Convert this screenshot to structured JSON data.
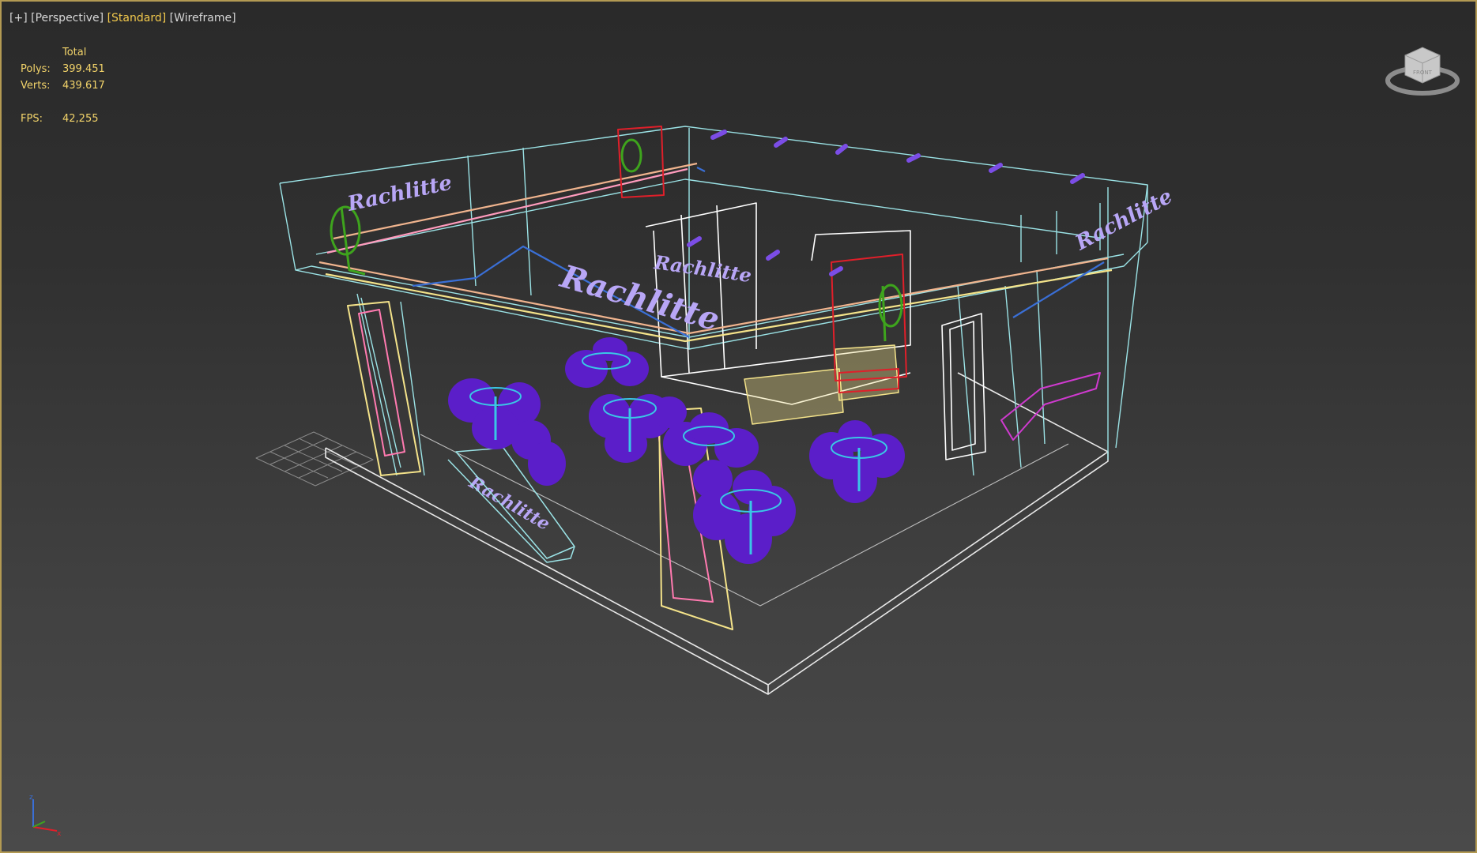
{
  "viewport": {
    "plus_label": "[+]",
    "view_label": "[Perspective]",
    "shading_label": "[Standard]",
    "display_label": "[Wireframe]"
  },
  "stats": {
    "header": "Total",
    "polys_label": "Polys:",
    "polys_value": "399.451",
    "verts_label": "Verts:",
    "verts_value": "439.617",
    "fps_label": "FPS:",
    "fps_value": "42,255"
  },
  "scene": {
    "signage": [
      "Rachlitte",
      "Rachlitte",
      "Rachlitte",
      "Rachlitte",
      "Rachlitte"
    ]
  },
  "viewcube": {
    "label": "FRONT"
  },
  "axis": {
    "x": "x",
    "y": "y",
    "z": "z"
  },
  "colors": {
    "frame": "#b39a53",
    "stats_text": "#f3d46a",
    "wire_cyan": "#9be3e6",
    "wire_white": "#ffffff",
    "wire_yellow": "#f4e38a",
    "wire_blue": "#3a6fd6",
    "wire_red": "#e01f2a",
    "wire_green": "#3ea41d",
    "wire_pink": "#ff7ab0",
    "furniture_purple": "#5b1ec9",
    "sign_lavender": "#b8a6f6"
  }
}
